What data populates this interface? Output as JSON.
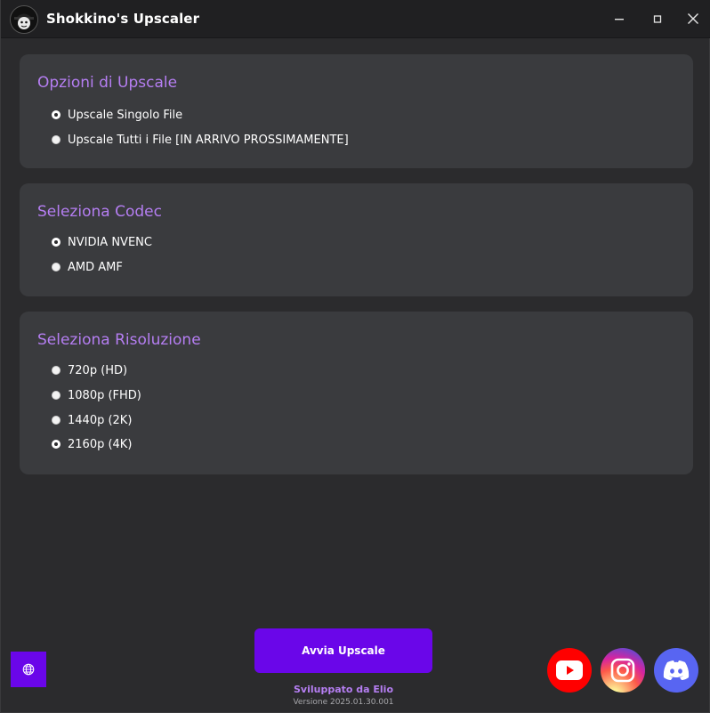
{
  "window": {
    "title": "Shokkino's Upscaler"
  },
  "sections": {
    "upscale_options": {
      "title": "Opzioni di Upscale",
      "options": [
        {
          "label": "Upscale Singolo File",
          "selected": true
        },
        {
          "label": "Upscale Tutti i File [IN ARRIVO PROSSIMAMENTE]",
          "selected": false
        }
      ]
    },
    "codec": {
      "title": "Seleziona Codec",
      "options": [
        {
          "label": "NVIDIA NVENC",
          "selected": true
        },
        {
          "label": "AMD AMF",
          "selected": false
        }
      ]
    },
    "resolution": {
      "title": "Seleziona Risoluzione",
      "options": [
        {
          "label": "720p (HD)",
          "selected": false
        },
        {
          "label": "1080p (FHD)",
          "selected": false
        },
        {
          "label": "1440p (2K)",
          "selected": false
        },
        {
          "label": "2160p (4K)",
          "selected": true
        }
      ]
    }
  },
  "footer": {
    "start_button": "Avvia Upscale",
    "developer": "Sviluppato da Elio",
    "version": "Versione 2025.01.30.001"
  },
  "icons": {
    "language": "globe-icon",
    "youtube": "youtube-icon",
    "instagram": "instagram-icon",
    "discord": "discord-icon"
  },
  "colors": {
    "accent": "#6a06e9",
    "title_purple": "#b57ef2",
    "panel_bg": "#3a3b3e",
    "window_bg": "#2b2b2d"
  }
}
